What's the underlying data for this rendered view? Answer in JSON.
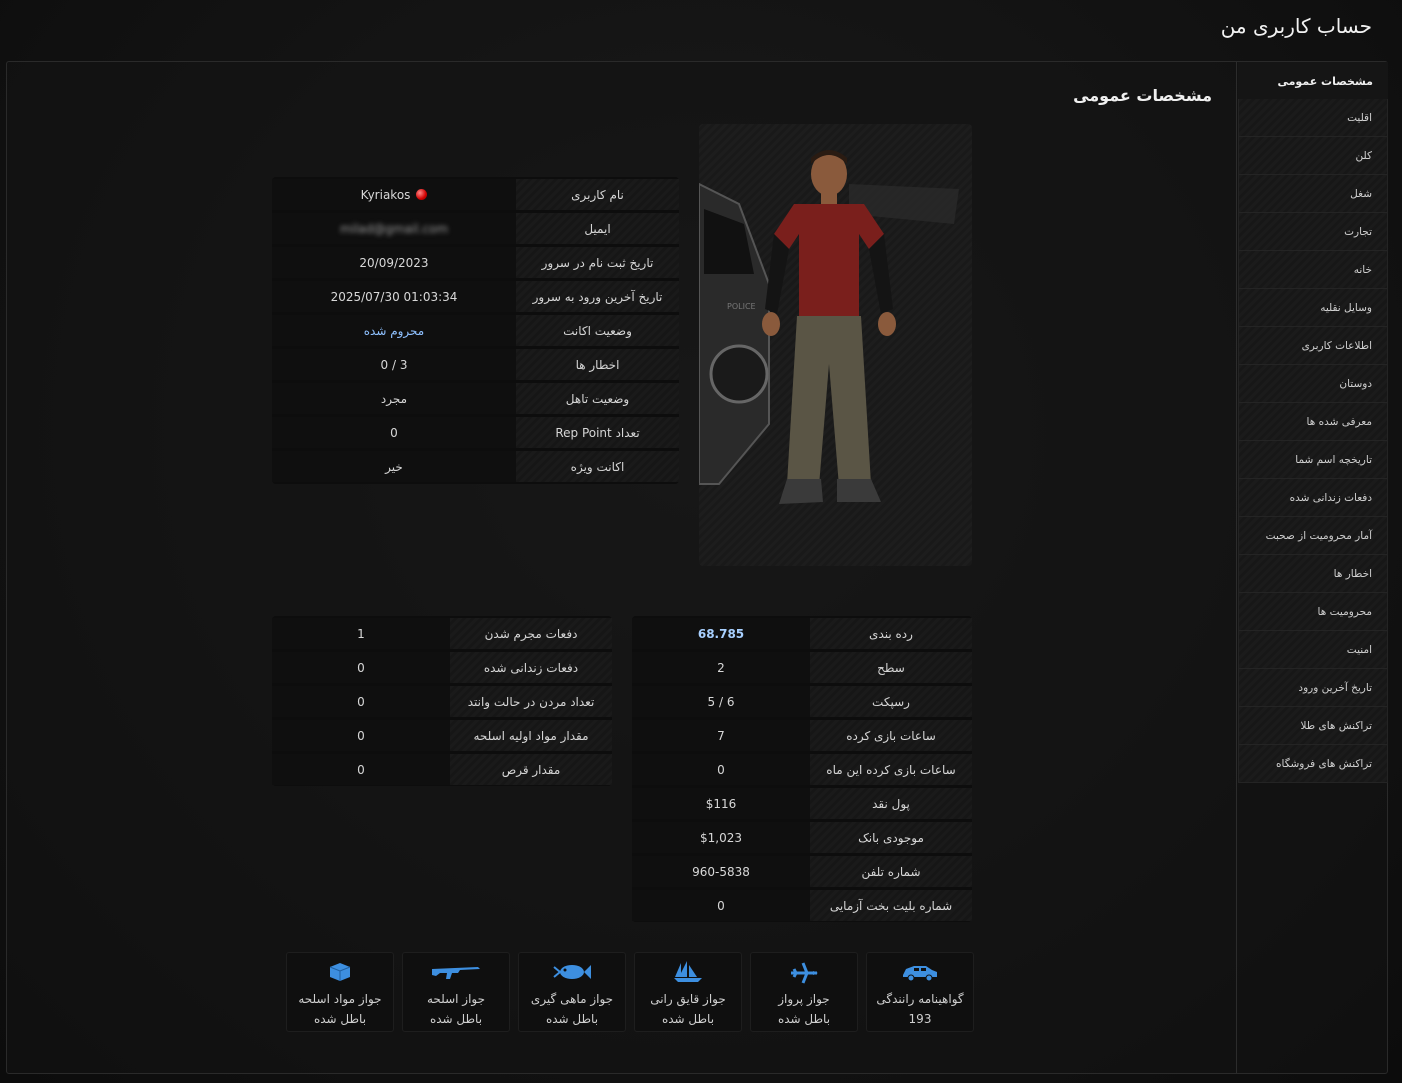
{
  "page": {
    "title": "حساب کاربری من",
    "section_title": "مشخصات عمومی"
  },
  "sidebar": {
    "active": "مشخصات عمومی",
    "items": [
      "اقلیت",
      "کلن",
      "شغل",
      "تجارت",
      "خانه",
      "وسایل نقلیه",
      "اطلاعات کاربری",
      "دوستان",
      "معرفی شده ها",
      "تاریخچه اسم شما",
      "دفعات زندانی شده",
      "آمار محرومیت از صحبت",
      "اخطار ها",
      "محرومیت ها",
      "امنیت",
      "تاریخ آخرین ورود",
      "تراکنش های طلا",
      "تراکنش های فروشگاه"
    ]
  },
  "account": {
    "username_label": "نام کاربری",
    "username": "Kyriakos",
    "email_label": "ایمیل",
    "email": "milad@gmail.com",
    "register_label": "تاریخ ثبت نام در سرور",
    "register": "20/09/2023",
    "last_login_label": "تاریخ آخرین ورود به سرور",
    "last_login": "2025/07/30 01:03:34",
    "status_label": "وضعیت اکانت",
    "status": "محروم شده",
    "warnings_label": "اخطار ها",
    "warnings": "0 / 3",
    "marital_label": "وضعیت تاهل",
    "marital": "مجرد",
    "rep_label": "تعداد Rep Point",
    "rep": "0",
    "vip_label": "اکانت ویژه",
    "vip": "خیر"
  },
  "stats": {
    "rank_label": "رده بندی",
    "rank": "68.785",
    "level_label": "سطح",
    "level": "2",
    "respect_label": "رسپکت",
    "respect": "5 / 6",
    "hours_label": "ساعات بازی کرده",
    "hours": "7",
    "hours_month_label": "ساعات بازی کرده این ماه",
    "hours_month": "0",
    "cash_label": "پول نقد",
    "cash": "$116",
    "bank_label": "موجودی بانک",
    "bank": "$1,023",
    "phone_label": "شماره تلفن",
    "phone": "960-5838",
    "lottery_label": "شماره بلیت بخت آزمایی",
    "lottery": "0"
  },
  "crime": {
    "criminal_label": "دفعات مجرم شدن",
    "criminal": "1",
    "jailed_label": "دفعات زندانی شده",
    "jailed": "0",
    "wanted_death_label": "تعداد مردن در حالت وانتد",
    "wanted_death": "0",
    "materials_label": "مقدار مواد اولیه اسلحه",
    "materials": "0",
    "pills_label": "مقدار قرص",
    "pills": "0"
  },
  "licenses": [
    {
      "icon": "car-icon",
      "title": "گواهینامه رانندگی",
      "value": "193"
    },
    {
      "icon": "airplane-icon",
      "title": "جواز پرواز",
      "value": "باطل شده"
    },
    {
      "icon": "sailboat-icon",
      "title": "جواز قایق رانی",
      "value": "باطل شده"
    },
    {
      "icon": "fish-icon",
      "title": "جواز ماهی گیری",
      "value": "باطل شده"
    },
    {
      "icon": "rifle-icon",
      "title": "جواز اسلحه",
      "value": "باطل شده"
    },
    {
      "icon": "box-icon",
      "title": "جواز مواد اسلحه",
      "value": "باطل شده"
    }
  ],
  "colors": {
    "accent": "#3d8fe0",
    "link": "#8fc1ff",
    "status_dot": "#d00000"
  }
}
